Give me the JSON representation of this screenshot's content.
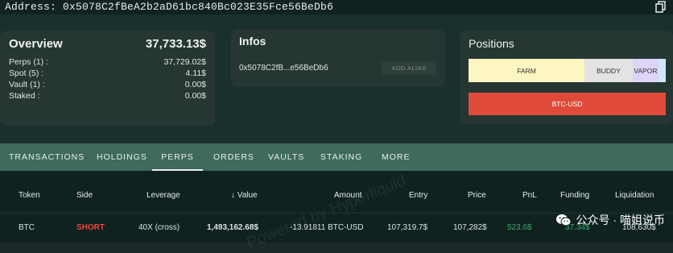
{
  "header": {
    "address": "Address: 0x5078C2fBeA2b2aD61bc840Bc023E35Fce56BeDb6"
  },
  "overview": {
    "title": "Overview",
    "total": "37,733.13$",
    "rows": [
      {
        "label": "Perps (1) :",
        "value": "37,729.02$"
      },
      {
        "label": "Spot (5) :",
        "value": "4.11$"
      },
      {
        "label": "Vault (1) :",
        "value": "0.00$"
      },
      {
        "label": "Staked :",
        "value": "0.00$"
      }
    ]
  },
  "infos": {
    "title": "Infos",
    "address_short": "0x5078C2fB...e56BeDb6",
    "alias_button": "ADD ALIAS"
  },
  "positions": {
    "title": "Positions",
    "segments": [
      "FARM",
      "BUDDY",
      "VAPOR",
      ""
    ],
    "btc_bar": "BTC-USD"
  },
  "tabs": [
    "TRANSACTIONS",
    "HOLDINGS",
    "PERPS",
    "ORDERS",
    "VAULTS",
    "STAKING",
    "MORE"
  ],
  "active_tab": "PERPS",
  "table": {
    "headers": [
      "Token",
      "Side",
      "Leverage",
      "↓ Value",
      "Amount",
      "Entry",
      "Price",
      "PnL",
      "Funding",
      "Liquidation"
    ],
    "row": [
      "BTC",
      "SHORT",
      "40X (cross)",
      "1,493,162.68$",
      "-13.91811 BTC-USD",
      "107,319.7$",
      "107,282$",
      "523.6$",
      "37.34$",
      "108,630$"
    ]
  },
  "watermark": "Powered by Hyperliquid",
  "overlay": {
    "wechat_text": "公众号 · 喵姐说币"
  },
  "colors": {
    "short": "#e8473a",
    "positive": "#3fa86b",
    "farm": "#fdf5c2",
    "btc_bar": "#e04b39"
  }
}
